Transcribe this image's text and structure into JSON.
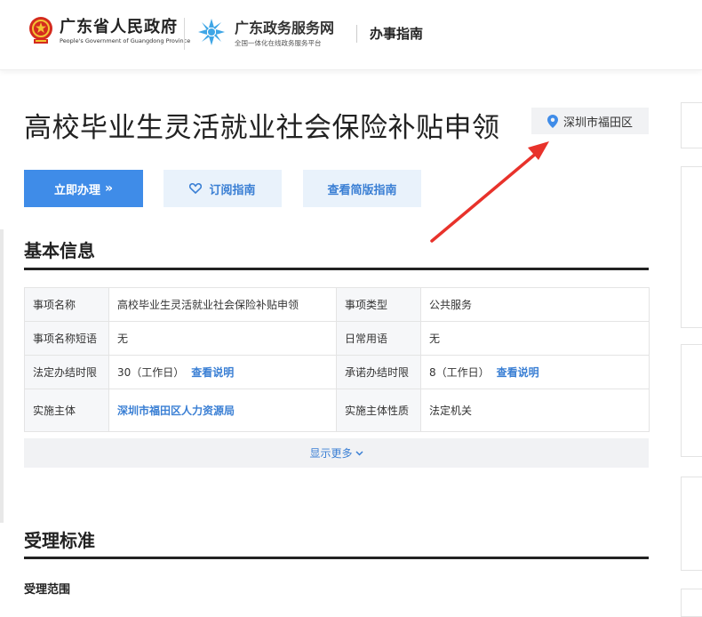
{
  "header": {
    "gov_name": "广东省人民政府",
    "gov_name_en": "People's Government of Guangdong Province",
    "service_name": "广东政务服务网",
    "service_tagline": "全国一体化在线政务服务平台",
    "nav_label": "办事指南"
  },
  "page": {
    "title": "高校毕业生灵活就业社会保险补贴申领",
    "location": "深圳市福田区"
  },
  "actions": {
    "apply_label": "立即办理",
    "subscribe_label": "订阅指南",
    "simple_label": "查看简版指南"
  },
  "basic_info": {
    "section_title": "基本信息",
    "rows": [
      {
        "label1": "事项名称",
        "value1": "高校毕业生灵活就业社会保险补贴申领",
        "label2": "事项类型",
        "value2": "公共服务"
      },
      {
        "label1": "事项名称短语",
        "value1": "无",
        "label2": "日常用语",
        "value2": "无"
      },
      {
        "label1": "法定办结时限",
        "value1": "30（工作日）",
        "link1": "查看说明",
        "label2": "承诺办结时限",
        "value2": "8（工作日）",
        "link2": "查看说明"
      },
      {
        "label1": "实施主体",
        "value1": "深圳市福田区人力资源局",
        "label2": "实施主体性质",
        "value2": "法定机关"
      }
    ],
    "show_more": "显示更多"
  },
  "acceptance": {
    "section_title": "受理标准",
    "scope_label": "受理范围"
  },
  "colors": {
    "primary": "#3f8ce8",
    "link": "#3a7fd4",
    "light_button_bg": "#e9f2fb",
    "annotation_arrow": "#e8322b"
  }
}
